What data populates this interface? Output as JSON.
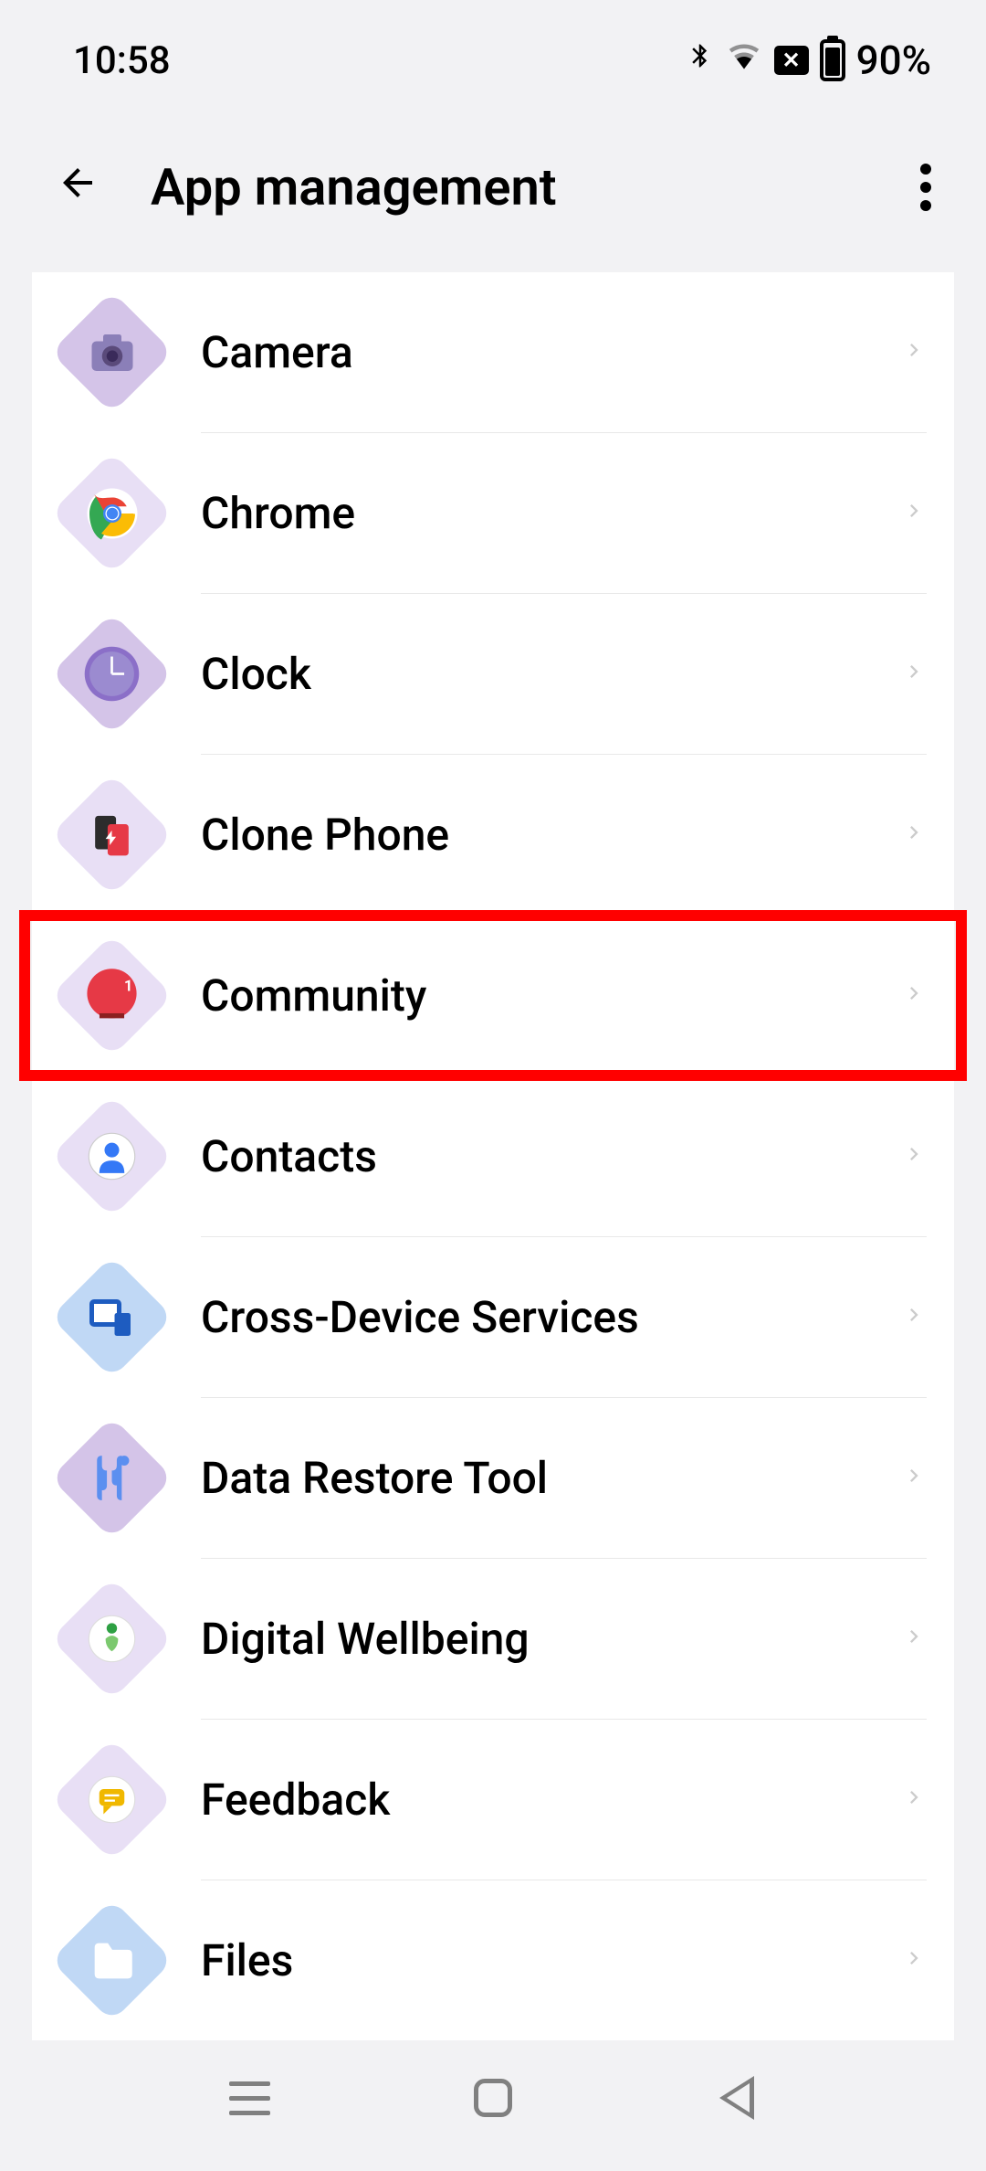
{
  "status_bar": {
    "time": "10:58",
    "battery_percent": "90%"
  },
  "header": {
    "title": "App management"
  },
  "apps": [
    {
      "name": "Camera",
      "icon_bg": "#d4c4e8",
      "icon_color": "#8b7fb8",
      "glyph": "📷"
    },
    {
      "name": "Chrome",
      "icon_bg": "#e8dff5",
      "icon_color": "#fff",
      "glyph": "chrome"
    },
    {
      "name": "Clock",
      "icon_bg": "#d4c4e8",
      "icon_color": "#8b6fc8",
      "glyph": "clock"
    },
    {
      "name": "Clone Phone",
      "icon_bg": "#e8dff5",
      "icon_color": "#fff",
      "glyph": "clone"
    },
    {
      "name": "Community",
      "icon_bg": "#e8dff5",
      "icon_color": "#e63946",
      "glyph": "community",
      "highlighted": true
    },
    {
      "name": "Contacts",
      "icon_bg": "#e8dff5",
      "icon_color": "#3478f6",
      "glyph": "contact"
    },
    {
      "name": "Cross-Device Services",
      "icon_bg": "#c0d8f5",
      "icon_color": "#1e5cc0",
      "glyph": "cross"
    },
    {
      "name": "Data Restore Tool",
      "icon_bg": "#d4c4e8",
      "icon_color": "#5b8ff0",
      "glyph": "restore"
    },
    {
      "name": "Digital Wellbeing",
      "icon_bg": "#e8dff5",
      "icon_color": "#fff",
      "glyph": "wellbeing"
    },
    {
      "name": "Feedback",
      "icon_bg": "#e8dff5",
      "icon_color": "#f0b800",
      "glyph": "feedback"
    },
    {
      "name": "Files",
      "icon_bg": "#c0d8f5",
      "icon_color": "#4a7ed8",
      "glyph": "files"
    }
  ]
}
